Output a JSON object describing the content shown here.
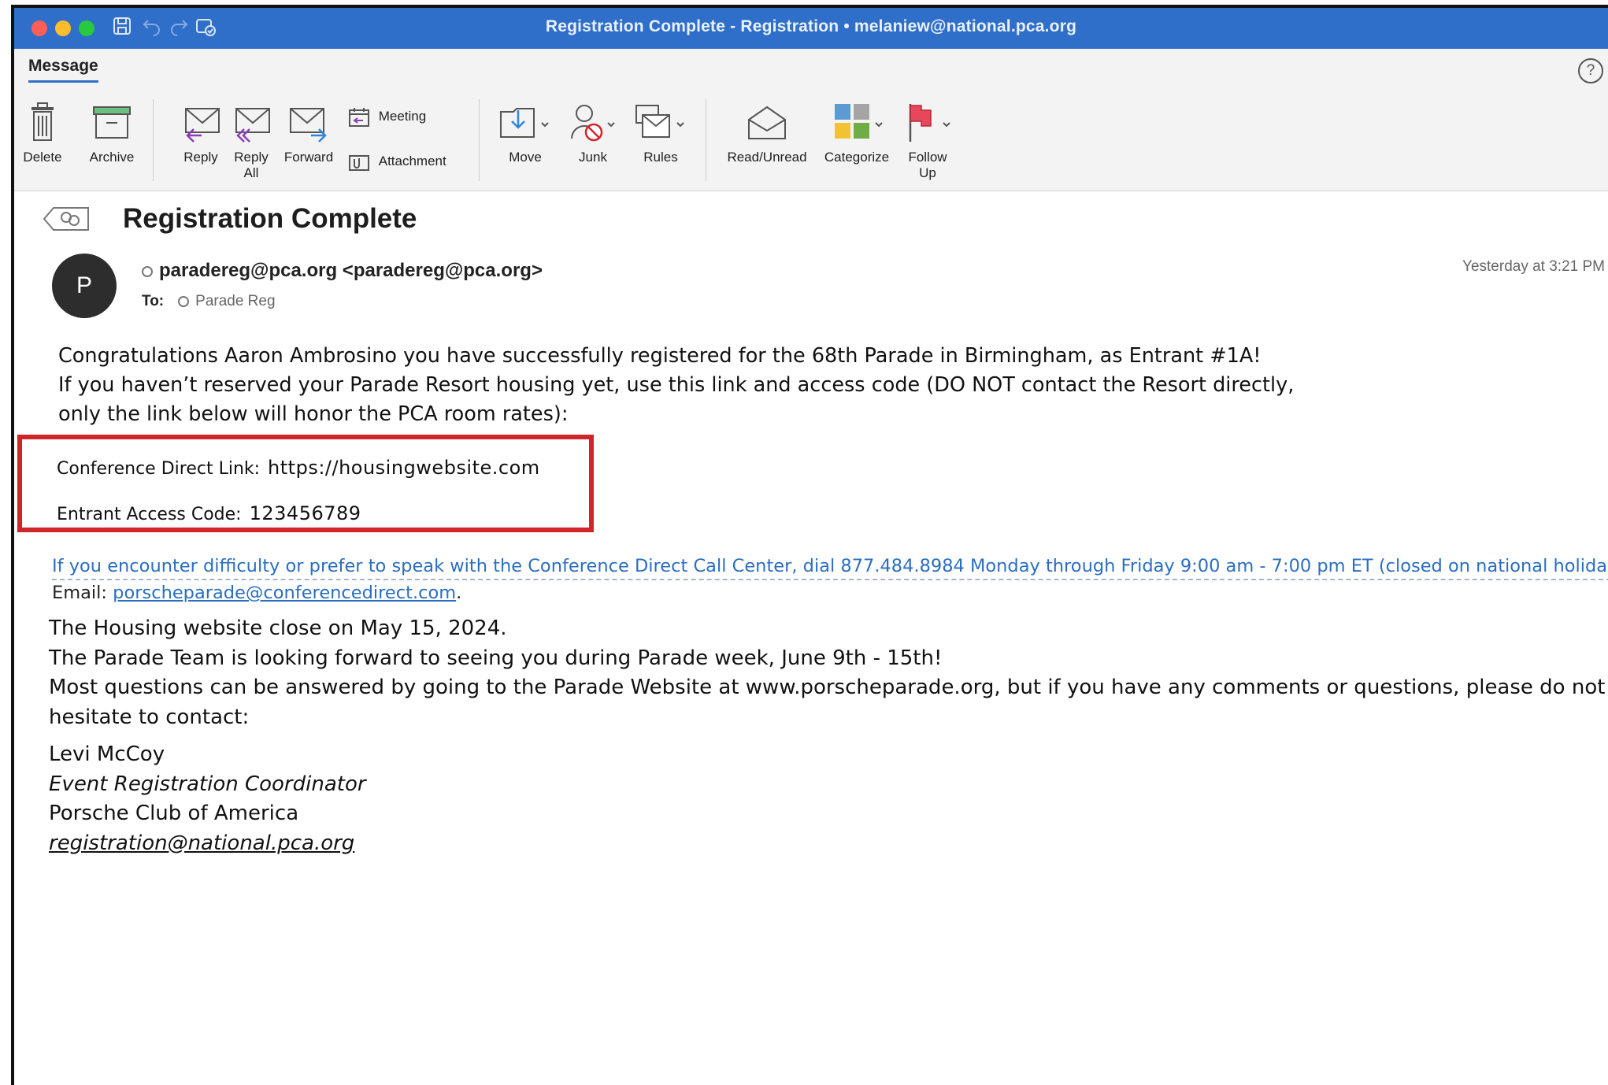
{
  "window": {
    "title": "Registration Complete - Registration • melaniew@national.pca.org"
  },
  "ribbon": {
    "tab": "Message",
    "buttons": {
      "delete": "Delete",
      "archive": "Archive",
      "reply": "Reply",
      "reply_all_1": "Reply",
      "reply_all_2": "All",
      "forward": "Forward",
      "meeting": "Meeting",
      "attachment": "Attachment",
      "move": "Move",
      "junk": "Junk",
      "rules": "Rules",
      "read_unread": "Read/Unread",
      "categorize": "Categorize",
      "follow_up_1": "Follow",
      "follow_up_2": "Up"
    }
  },
  "message": {
    "subject": "Registration Complete",
    "avatar_letter": "P",
    "from": "paradereg@pca.org <paradereg@pca.org>",
    "to_label": "To:",
    "to": "Parade Reg",
    "timestamp": "Yesterday at 3:21 PM",
    "body": {
      "line1": "Congratulations Aaron Ambrosino you have successfully registered for the 68th Parade in Birmingham, as Entrant #1A!",
      "line2": "If you haven’t reserved your Parade Resort housing yet, use this link and access code (DO NOT contact the Resort directly,",
      "line3": "only the link below will honor the PCA room rates):",
      "link_label": "Conference Direct Link:",
      "link_value": "https://housingwebsite.com",
      "code_label": "Entrant Access Code:",
      "code_value": "123456789",
      "notice": "If you encounter difficulty or prefer to speak with the Conference Direct Call Center, dial 877.484.8984 Monday through Friday 9:00 am - 7:00 pm ET (closed on national holidays).",
      "email_label": "Email:",
      "email_link": "porscheparade@conferencedirect.com",
      "email_suffix": ".",
      "info1": "The Housing website close on May 15, 2024.",
      "info2": "The Parade Team is looking forward to seeing you during Parade week, June 9th - 15th!",
      "info3": "Most questions can be answered by going to the Parade Website at www.porscheparade.org, but if you have any comments or questions, please do not hesitate to contact:"
    },
    "signature": {
      "name": "Levi McCoy",
      "role": "Event Registration Coordinator",
      "org": "Porsche Club of America",
      "email": "registration@national.pca.org"
    }
  },
  "colors": {
    "titlebar": "#2f6fc9",
    "highlight_border": "#d0262a",
    "link": "#2b6ec0"
  },
  "icons": [
    "close-dot",
    "minimize-dot",
    "maximize-dot",
    "save-icon",
    "undo-icon",
    "redo-icon",
    "sync-icon",
    "help-icon",
    "trash-icon",
    "archive-icon",
    "reply-icon",
    "reply-all-icon",
    "forward-icon",
    "meeting-icon",
    "attachment-icon",
    "move-icon",
    "junk-icon",
    "rules-icon",
    "envelope-open-icon",
    "categorize-icon",
    "flag-icon",
    "conversation-icon"
  ]
}
